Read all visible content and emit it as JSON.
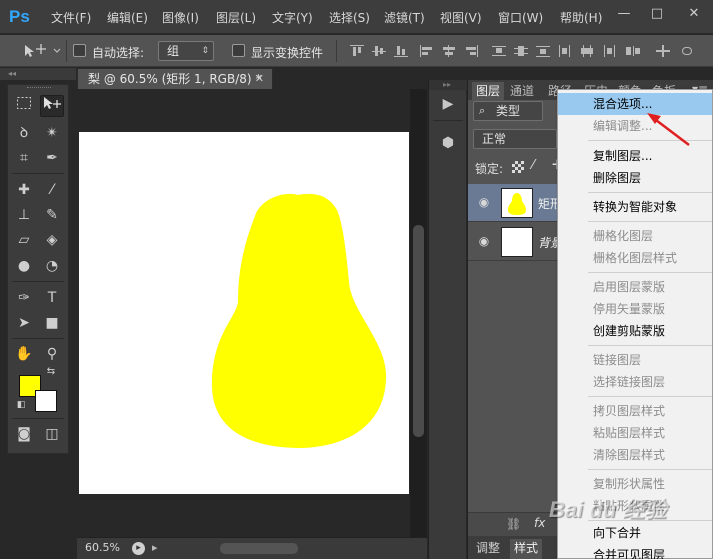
{
  "app": {
    "logo": "Ps"
  },
  "menubar": {
    "items": [
      "文件(F)",
      "编辑(E)",
      "图像(I)",
      "图层(L)",
      "文字(Y)",
      "选择(S)",
      "滤镜(T)",
      "视图(V)",
      "窗口(W)",
      "帮助(H)"
    ],
    "window_buttons": [
      "—",
      "□",
      "✕"
    ]
  },
  "options": {
    "auto_select_label": "自动选择:",
    "auto_select_value": "组",
    "show_transform_label": "显示变换控件"
  },
  "document": {
    "tab_title": "梨 @ 60.5% (矩形 1, RGB/8) *",
    "zoom": "60.5%",
    "shape_color": "#ffff00",
    "canvas_color": "#ffffff"
  },
  "toolbar": {
    "foreground_color": "#ffff00",
    "background_color": "#ffffff",
    "type_tool_glyph": "T"
  },
  "layers_panel": {
    "tabs": [
      "图层",
      "通道",
      "路径",
      "历史",
      "颜色",
      "色板"
    ],
    "filter_label": "类型",
    "blend_mode": "正常",
    "lock_label": "锁定:",
    "layers": [
      {
        "name": "矩形",
        "selected": true
      },
      {
        "name": "背景",
        "selected": false
      }
    ],
    "bottom_icons": [
      "link-icon",
      "fx-icon"
    ],
    "fx_label": "fx",
    "lower_tabs": [
      "调整",
      "样式"
    ]
  },
  "context_menu": {
    "items": [
      {
        "label": "混合选项...",
        "enabled": true,
        "highlight": true
      },
      {
        "label": "编辑调整...",
        "enabled": false
      },
      {
        "label": "复制图层...",
        "enabled": true
      },
      {
        "label": "删除图层",
        "enabled": true
      },
      {
        "label": "转换为智能对象",
        "enabled": true
      },
      {
        "label": "栅格化图层",
        "enabled": false
      },
      {
        "label": "栅格化图层样式",
        "enabled": false
      },
      {
        "label": "启用图层蒙版",
        "enabled": false
      },
      {
        "label": "停用矢量蒙版",
        "enabled": false
      },
      {
        "label": "创建剪贴蒙版",
        "enabled": true
      },
      {
        "label": "链接图层",
        "enabled": false
      },
      {
        "label": "选择链接图层",
        "enabled": false
      },
      {
        "label": "拷贝图层样式",
        "enabled": false
      },
      {
        "label": "粘贴图层样式",
        "enabled": false
      },
      {
        "label": "清除图层样式",
        "enabled": false
      },
      {
        "label": "复制形状属性",
        "enabled": false
      },
      {
        "label": "粘贴形状属性",
        "enabled": false
      },
      {
        "label": "向下合并",
        "enabled": true
      },
      {
        "label": "合并可见图层",
        "enabled": true
      }
    ],
    "highlight_color": "#99c9ef"
  },
  "watermark": {
    "text": "Bai du 经验"
  }
}
